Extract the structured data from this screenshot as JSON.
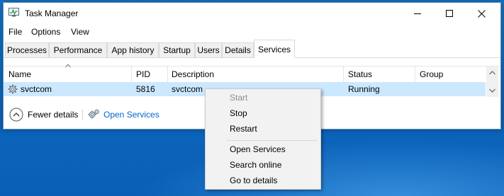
{
  "window": {
    "title": "Task Manager"
  },
  "menubar": {
    "items": [
      "File",
      "Options",
      "View"
    ]
  },
  "tabs": [
    {
      "label": "Processes",
      "active": false
    },
    {
      "label": "Performance",
      "active": false
    },
    {
      "label": "App history",
      "active": false
    },
    {
      "label": "Startup",
      "active": false
    },
    {
      "label": "Users",
      "active": false
    },
    {
      "label": "Details",
      "active": false
    },
    {
      "label": "Services",
      "active": true
    }
  ],
  "grid": {
    "columns": [
      "Name",
      "PID",
      "Description",
      "Status",
      "Group"
    ],
    "rows": [
      {
        "name": "svctcom",
        "pid": "5816",
        "description": "svctcom",
        "status": "Running",
        "group": ""
      }
    ]
  },
  "footer": {
    "fewer_details": "Fewer details",
    "open_services": "Open Services"
  },
  "context_menu": {
    "items": [
      {
        "label": "Start",
        "enabled": false
      },
      {
        "label": "Stop",
        "enabled": true
      },
      {
        "label": "Restart",
        "enabled": true
      },
      {
        "label": "Open Services",
        "enabled": true
      },
      {
        "label": "Search online",
        "enabled": true
      },
      {
        "label": "Go to details",
        "enabled": true
      }
    ]
  },
  "colors": {
    "selected_row": "#cce8ff",
    "link": "#0066cc",
    "desktop": "#0c67bf"
  }
}
